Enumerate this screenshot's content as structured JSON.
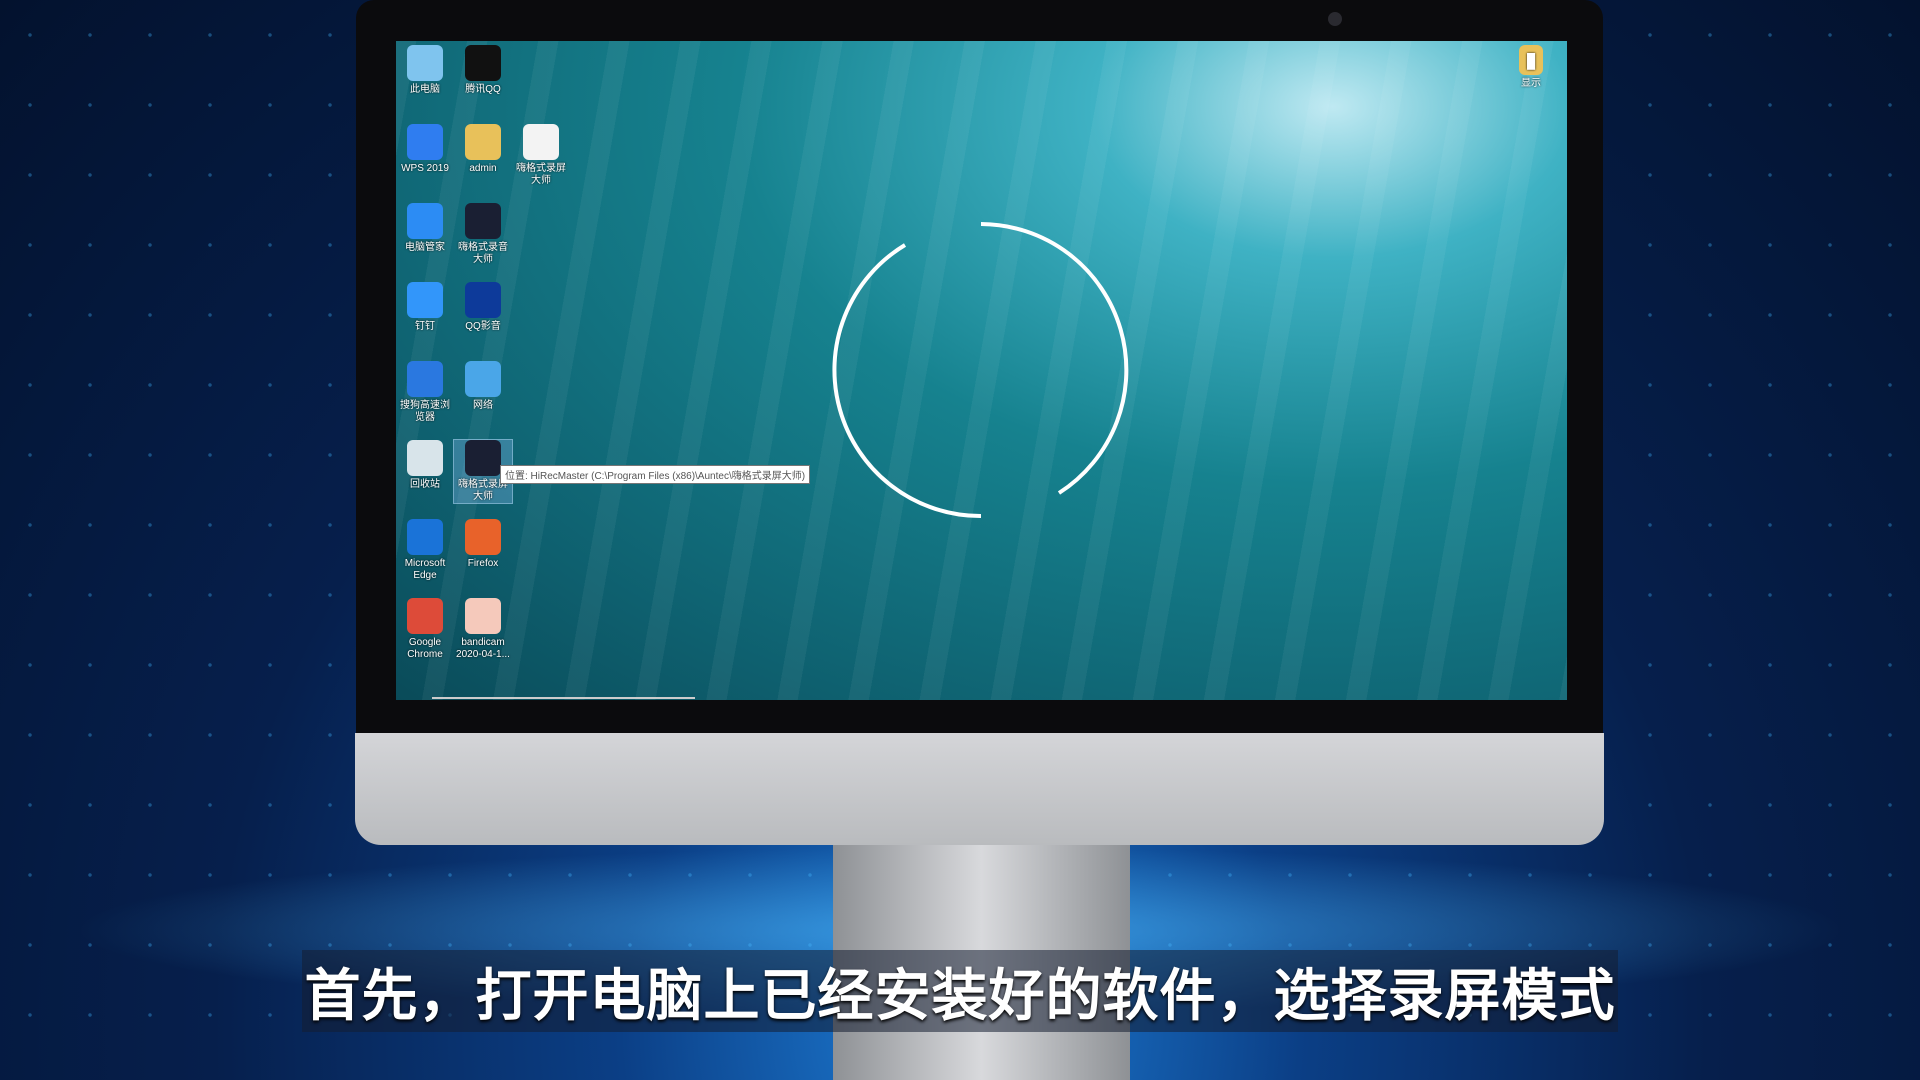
{
  "desktop": {
    "icons": [
      {
        "label": "此电脑",
        "icon": "computer-icon",
        "color": "#7fc4ee"
      },
      {
        "label": "腾讯QQ",
        "icon": "qq-penguin-icon",
        "color": "#111111"
      },
      {
        "label": "WPS 2019",
        "icon": "wps-icon",
        "color": "#2f7df0"
      },
      {
        "label": "admin",
        "icon": "user-folder-icon",
        "color": "#e8c15a"
      },
      {
        "label": "嗨格式录屏大师",
        "icon": "ppt-file-icon",
        "color": "#f3f3f3"
      },
      {
        "label": "电脑管家",
        "icon": "shield-icon",
        "color": "#2c8cf4"
      },
      {
        "label": "嗨格式录音大师",
        "icon": "microphone-icon",
        "color": "#1a1f33"
      },
      {
        "label": "钉钉",
        "icon": "dingtalk-icon",
        "color": "#3296fa"
      },
      {
        "label": "QQ影音",
        "icon": "qq-player-icon",
        "color": "#0d3a9a"
      },
      {
        "label": "搜狗高速浏览器",
        "icon": "sogou-browser-icon",
        "color": "#2a78e0"
      },
      {
        "label": "网络",
        "icon": "network-icon",
        "color": "#4aa6e8"
      },
      {
        "label": "回收站",
        "icon": "recycle-bin-icon",
        "color": "#d8e4ea"
      },
      {
        "label": "嗨格式录屏大师",
        "icon": "screen-recorder-icon",
        "color": "#1a1f33"
      },
      {
        "label": "Microsoft Edge",
        "icon": "edge-icon",
        "color": "#1a73d8"
      },
      {
        "label": "Firefox",
        "icon": "firefox-icon",
        "color": "#e8622a"
      },
      {
        "label": "Google Chrome",
        "icon": "chrome-icon",
        "color": "#dd4b39"
      },
      {
        "label": "bandicam 2020-04-1...",
        "icon": "mp4-file-icon",
        "color": "#f5c9bb"
      }
    ],
    "corner_icon": {
      "label": "显示",
      "icon": "book-folder-icon"
    },
    "tooltip": "位置: HiRecMaster (C:\\Program Files (x86)\\Auntec\\嗨格式录屏大师)",
    "loading": "spinner"
  },
  "subtitle": "首先，打开电脑上已经安装好的软件，选择录屏模式"
}
